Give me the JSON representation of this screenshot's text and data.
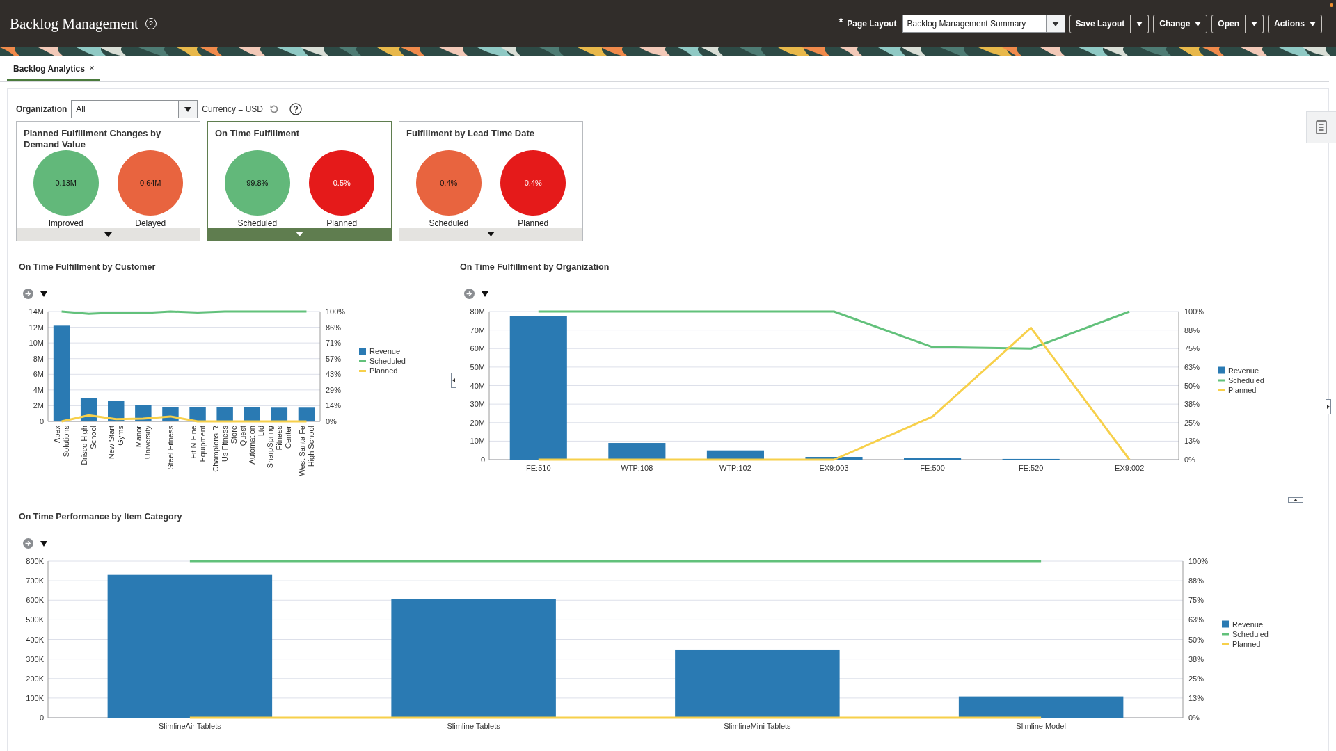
{
  "header": {
    "title": "Backlog Management",
    "help": "?",
    "layout_field": {
      "required_mark": "*",
      "label": "Page Layout",
      "value": "Backlog Management Summary"
    },
    "buttons": [
      {
        "label": "Save Layout",
        "kind": "split"
      },
      {
        "label": "Change",
        "kind": "menu"
      },
      {
        "label": "Open",
        "kind": "split"
      },
      {
        "label": "Actions",
        "kind": "menu"
      }
    ]
  },
  "tabs": [
    {
      "label": "Backlog Analytics",
      "close": "×",
      "selected": true
    }
  ],
  "filters": {
    "organization_label": "Organization",
    "organization_value": "All",
    "currency": "Currency = USD"
  },
  "cards": [
    {
      "title": "Planned Fulfillment Changes by Demand Value",
      "selected": false,
      "bubbles": [
        {
          "value": "0.13M",
          "label": "Improved",
          "color": "#62b87a"
        },
        {
          "value": "0.64M",
          "label": "Delayed",
          "color": "#e8643f"
        }
      ]
    },
    {
      "title": "On Time Fulfillment",
      "selected": true,
      "bubbles": [
        {
          "value": "99.8%",
          "label": "Scheduled",
          "color": "#62b87a"
        },
        {
          "value": "0.5%",
          "label": "Planned",
          "color": "#e51a1a"
        }
      ]
    },
    {
      "title": "Fulfillment by Lead Time Date",
      "selected": false,
      "bubbles": [
        {
          "value": "0.4%",
          "label": "Scheduled",
          "color": "#e8643f"
        },
        {
          "value": "0.4%",
          "label": "Planned",
          "color": "#e51a1a"
        }
      ]
    }
  ],
  "charts": [
    {
      "title": "On Time Fulfillment by Customer",
      "chart_data": {
        "type": "bar",
        "categories": [
          "Apex Solutions",
          "Drisco High School",
          "New Start Gyms",
          "Manor University",
          "Steel Fitness",
          "Fit N Fine Equipment",
          "Champions R Us Fitness Store",
          "Quest Automation Ltd",
          "SharpSpring Fitness Center",
          "West Santa Fe High School"
        ],
        "series": [
          {
            "name": "Revenue",
            "color": "#2a7ab3",
            "type": "bar",
            "axis": "y",
            "values": [
              12.2,
              3.0,
              2.6,
              2.1,
              1.8,
              1.8,
              1.8,
              1.8,
              1.75,
              1.75
            ]
          },
          {
            "name": "Scheduled",
            "color": "#62c17b",
            "type": "line",
            "axis": "y2",
            "values": [
              100,
              98,
              99,
              98.5,
              100,
              99,
              100,
              100,
              100,
              100
            ]
          },
          {
            "name": "Planned",
            "color": "#f7d04b",
            "type": "line",
            "axis": "y2",
            "values": [
              0,
              5.5,
              2,
              2.5,
              4.5,
              0,
              0,
              0,
              0,
              0
            ]
          }
        ],
        "ylim": [
          0,
          14
        ],
        "y2lim": [
          0,
          100
        ],
        "grid": true,
        "legend": "right",
        "yticks": [
          {
            "value": 0,
            "label": "0"
          },
          {
            "value": 2,
            "label": "2M"
          },
          {
            "value": 4,
            "label": "4M"
          },
          {
            "value": 6,
            "label": "6M"
          },
          {
            "value": 8,
            "label": "8M"
          },
          {
            "value": 10,
            "label": "10M"
          },
          {
            "value": 12,
            "label": "12M"
          },
          {
            "value": 14,
            "label": "14M"
          }
        ],
        "y2ticks": [
          {
            "value": 0,
            "label": "0%"
          },
          {
            "value": 14.29,
            "label": "14%"
          },
          {
            "value": 28.57,
            "label": "29%"
          },
          {
            "value": 42.86,
            "label": "43%"
          },
          {
            "value": 57.14,
            "label": "57%"
          },
          {
            "value": 71.43,
            "label": "71%"
          },
          {
            "value": 85.71,
            "label": "86%"
          },
          {
            "value": 100,
            "label": "100%"
          }
        ]
      }
    },
    {
      "title": "On Time Fulfillment by Organization",
      "chart_data": {
        "type": "bar",
        "categories": [
          "FE:510",
          "WTP:108",
          "WTP:102",
          "EX9:003",
          "FE:500",
          "FE:520",
          "EX9:002"
        ],
        "series": [
          {
            "name": "Revenue",
            "color": "#2a7ab3",
            "type": "bar",
            "axis": "y",
            "values": [
              77.5,
              9,
              5,
              1.5,
              0.8,
              0.4,
              0
            ]
          },
          {
            "name": "Scheduled",
            "color": "#62c17b",
            "type": "line",
            "axis": "y2",
            "values": [
              100,
              100,
              100,
              100,
              76,
              75,
              100
            ]
          },
          {
            "name": "Planned",
            "color": "#f7d04b",
            "type": "line",
            "axis": "y2",
            "values": [
              0,
              0,
              0,
              0,
              29,
              89,
              0
            ]
          }
        ],
        "ylim": [
          0,
          80
        ],
        "y2lim": [
          0,
          100
        ],
        "grid": true,
        "legend": "right",
        "yticks": [
          {
            "value": 0,
            "label": "0"
          },
          {
            "value": 10,
            "label": "10M"
          },
          {
            "value": 20,
            "label": "20M"
          },
          {
            "value": 30,
            "label": "30M"
          },
          {
            "value": 40,
            "label": "40M"
          },
          {
            "value": 50,
            "label": "50M"
          },
          {
            "value": 60,
            "label": "60M"
          },
          {
            "value": 70,
            "label": "70M"
          },
          {
            "value": 80,
            "label": "80M"
          }
        ],
        "y2ticks": [
          {
            "value": 0,
            "label": "0%"
          },
          {
            "value": 12.5,
            "label": "13%"
          },
          {
            "value": 25,
            "label": "25%"
          },
          {
            "value": 37.5,
            "label": "38%"
          },
          {
            "value": 50,
            "label": "50%"
          },
          {
            "value": 62.5,
            "label": "63%"
          },
          {
            "value": 75,
            "label": "75%"
          },
          {
            "value": 87.5,
            "label": "88%"
          },
          {
            "value": 100,
            "label": "100%"
          }
        ]
      }
    },
    {
      "title": "On Time Performance by Item Category",
      "chart_data": {
        "type": "bar",
        "categories": [
          "SlimlineAir Tablets",
          "Slimline Tablets",
          "SlimlineMini Tablets",
          "Slimline Model"
        ],
        "series": [
          {
            "name": "Revenue",
            "color": "#2a7ab3",
            "type": "bar",
            "axis": "y",
            "values": [
              730,
              605,
              345,
              108
            ]
          },
          {
            "name": "Scheduled",
            "color": "#62c17b",
            "type": "line",
            "axis": "y2",
            "values": [
              100,
              100,
              100,
              100
            ]
          },
          {
            "name": "Planned",
            "color": "#f7d04b",
            "type": "line",
            "axis": "y2",
            "values": [
              0,
              0,
              0,
              0
            ]
          }
        ],
        "ylim": [
          0,
          800
        ],
        "y2lim": [
          0,
          100
        ],
        "grid": true,
        "legend": "right",
        "yticks": [
          {
            "value": 0,
            "label": "0"
          },
          {
            "value": 100,
            "label": "100K"
          },
          {
            "value": 200,
            "label": "200K"
          },
          {
            "value": 300,
            "label": "300K"
          },
          {
            "value": 400,
            "label": "400K"
          },
          {
            "value": 500,
            "label": "500K"
          },
          {
            "value": 600,
            "label": "600K"
          },
          {
            "value": 700,
            "label": "700K"
          },
          {
            "value": 800,
            "label": "800K"
          }
        ],
        "y2ticks": [
          {
            "value": 0,
            "label": "0%"
          },
          {
            "value": 12.5,
            "label": "13%"
          },
          {
            "value": 25,
            "label": "25%"
          },
          {
            "value": 37.5,
            "label": "38%"
          },
          {
            "value": 50,
            "label": "50%"
          },
          {
            "value": 62.5,
            "label": "63%"
          },
          {
            "value": 75,
            "label": "75%"
          },
          {
            "value": 87.5,
            "label": "88%"
          },
          {
            "value": 100,
            "label": "100%"
          }
        ]
      }
    }
  ]
}
